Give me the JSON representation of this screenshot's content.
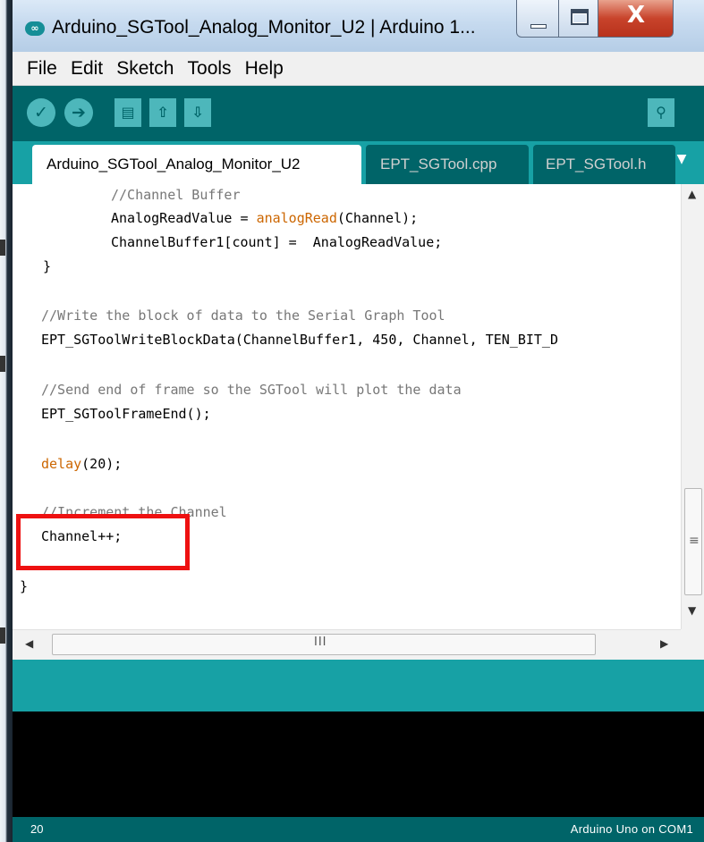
{
  "window": {
    "title": "Arduino_SGTool_Analog_Monitor_U2 | Arduino 1...",
    "icon": "arduino-infinity-icon",
    "close_glyph": "X"
  },
  "menu": [
    "File",
    "Edit",
    "Sketch",
    "Tools",
    "Help"
  ],
  "toolbar": {
    "verify_icon": "✓",
    "upload_icon": "➔",
    "new_icon": "▤",
    "open_icon": "⇧",
    "save_icon": "⇩",
    "serial_monitor_icon": "⚲"
  },
  "tabs": [
    {
      "label": "Arduino_SGTool_Analog_Monitor_U2",
      "active": true
    },
    {
      "label": "EPT_SGTool.cpp",
      "active": false
    },
    {
      "label": "EPT_SGTool.h",
      "active": false
    }
  ],
  "tab_menu_arrow": "▼",
  "code": {
    "line1": "//Channel Buffer",
    "line2_a": "AnalogReadValue = ",
    "line2_kw": "analogRead",
    "line2_b": "(Channel);",
    "line3": "ChannelBuffer1[count] =  AnalogReadValue;",
    "line4": "}",
    "line5": "//Write the block of data to the Serial Graph Tool",
    "line6": "EPT_SGToolWriteBlockData(ChannelBuffer1, 450, Channel, TEN_BIT_D",
    "line7": "//Send end of frame so the SGTool will plot the data",
    "line8": "EPT_SGToolFrameEnd();",
    "line9_kw": "delay",
    "line9_b": "(20);",
    "line10": "//Increment the Channel",
    "line11": "Channel++;",
    "line12": "}"
  },
  "scrollbars": {
    "up": "▲",
    "down": "▼",
    "left": "◀",
    "right": "▶",
    "v_grip": "≡",
    "h_grip": "III"
  },
  "footer": {
    "line_number": "20",
    "board": "Arduino Uno on COM1"
  },
  "colors": {
    "toolbar": "#006468",
    "tabbar": "#17a1a5",
    "icon_fill": "#4db7bb",
    "keyword": "#cc6600",
    "highlight": "#ee1111"
  }
}
